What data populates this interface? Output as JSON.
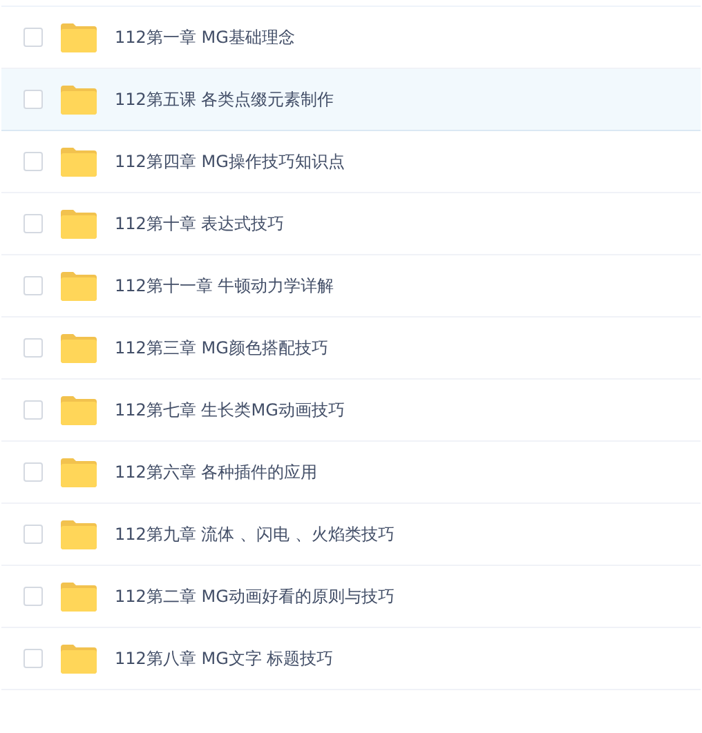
{
  "files": [
    {
      "name": "112第一章 MG基础理念",
      "checked": false,
      "highlighted": false
    },
    {
      "name": "112第五课 各类点缀元素制作",
      "checked": false,
      "highlighted": true
    },
    {
      "name": "112第四章 MG操作技巧知识点",
      "checked": false,
      "highlighted": false
    },
    {
      "name": "112第十章 表达式技巧",
      "checked": false,
      "highlighted": false
    },
    {
      "name": "112第十一章 牛顿动力学详解",
      "checked": false,
      "highlighted": false
    },
    {
      "name": "112第三章 MG颜色搭配技巧",
      "checked": false,
      "highlighted": false
    },
    {
      "name": "112第七章 生长类MG动画技巧",
      "checked": false,
      "highlighted": false
    },
    {
      "name": "112第六章 各种插件的应用",
      "checked": false,
      "highlighted": false
    },
    {
      "name": "112第九章 流体 、闪电 、火焰类技巧",
      "checked": false,
      "highlighted": false
    },
    {
      "name": "112第二章 MG动画好看的原则与技巧",
      "checked": false,
      "highlighted": false
    },
    {
      "name": "112第八章 MG文字 标题技巧",
      "checked": false,
      "highlighted": false
    }
  ]
}
